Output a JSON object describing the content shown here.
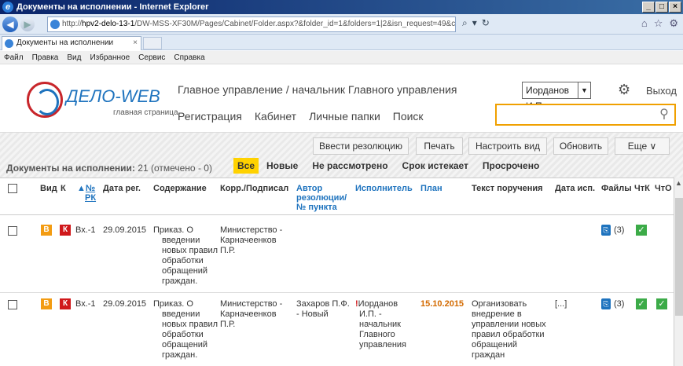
{
  "window": {
    "title": "Документы на исполнении - Internet Explorer"
  },
  "browser": {
    "url_prefix": "http://",
    "url_host": "hpv2-delo-13-1",
    "url_rest": "/DW-MSS-XF30M/Pages/Cabinet/Folder.aspx?&folder_id=1&folders=1|2&isn_request=49&card_id=0.2EZDX.&cabinet_id=4058328",
    "tab_label": "Документы на исполнении",
    "menu": [
      "Файл",
      "Правка",
      "Вид",
      "Избранное",
      "Сервис",
      "Справка"
    ]
  },
  "app": {
    "logo_title": "ДЕЛО-WEB",
    "logo_subtitle": "главная страница",
    "header_title": "Главное управление / начальник Главного управления",
    "user": "Иорданов И.П.",
    "exit_label": "Выход",
    "nav": [
      "Регистрация",
      "Кабинет",
      "Личные папки",
      "Поиск"
    ],
    "search_value": ""
  },
  "toolbar": {
    "btn_resolution": "Ввести резолюцию",
    "btn_print": "Печать",
    "btn_view": "Настроить вид",
    "btn_refresh": "Обновить",
    "btn_more": "Еще ∨"
  },
  "list": {
    "title": "Документы на исполнении:",
    "count": " 21 (отмечено - 0)",
    "filters": [
      "Все",
      "Новые",
      "Не рассмотрено",
      "Срок истекает",
      "Просрочено"
    ]
  },
  "table": {
    "headers": {
      "view": "Вид",
      "k": "К",
      "num_sort": "▲",
      "num_l1": "№",
      "num_l2": "РК",
      "date_reg": "Дата рег.",
      "content": "Содержание",
      "corr_l1": "Корр./Подписал",
      "author_l1": "Автор",
      "author_l2": "резолюции/",
      "author_l3": "№ пункта",
      "executor": "Исполнитель",
      "plan": "План",
      "task_text": "Текст поручения",
      "date_exec": "Дата исп.",
      "files": "Файлы",
      "chtk": "ЧтК",
      "chto": "ЧтО"
    },
    "rows": [
      {
        "badge_b": "В",
        "badge_k": "К",
        "num": "Вх.-1",
        "date": "29.09.2015",
        "content": [
          "Приказ. О",
          "введении",
          "новых правил",
          "обработки",
          "обращений",
          "граждан."
        ],
        "corr": [
          "Министерство -",
          "Карначеенков",
          "П.Р."
        ],
        "files": "(3)",
        "chtk": "✓"
      },
      {
        "badge_b": "В",
        "badge_k": "К",
        "num": "Вх.-1",
        "date": "29.09.2015",
        "content": [
          "Приказ. О",
          "введении",
          "новых правил",
          "обработки",
          "обращений",
          "граждан."
        ],
        "corr": [
          "Министерство -",
          "Карначеенков",
          "П.Р."
        ],
        "author": [
          "Захаров П.Ф.",
          "- Новый"
        ],
        "executor_mark": "!",
        "executor": [
          "Иорданов",
          "И.П. -",
          "начальник",
          "Главного",
          "управления"
        ],
        "plan": "15.10.2015",
        "task": [
          "Организовать",
          "внедрение в",
          "управлении новых",
          "правил обработки",
          "обращений",
          "граждан"
        ],
        "date_exec": "[...]",
        "files": "(3)",
        "chtk": "✓",
        "chto": "✓"
      }
    ]
  }
}
